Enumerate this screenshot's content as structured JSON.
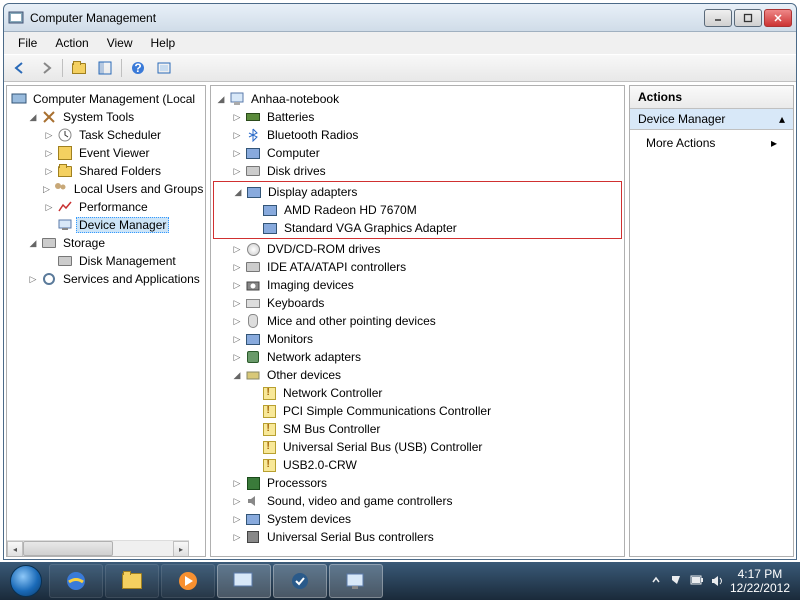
{
  "window": {
    "title": "Computer Management"
  },
  "menus": {
    "file": "File",
    "action": "Action",
    "view": "View",
    "help": "Help"
  },
  "left_tree": {
    "root": "Computer Management (Local",
    "system_tools": "System Tools",
    "task_scheduler": "Task Scheduler",
    "event_viewer": "Event Viewer",
    "shared_folders": "Shared Folders",
    "local_users": "Local Users and Groups",
    "performance": "Performance",
    "device_manager": "Device Manager",
    "storage": "Storage",
    "disk_management": "Disk Management",
    "services_apps": "Services and Applications"
  },
  "mid_tree": {
    "computer": "Anhaa-notebook",
    "batteries": "Batteries",
    "bluetooth": "Bluetooth Radios",
    "computer_cat": "Computer",
    "disk_drives": "Disk drives",
    "display_adapters": "Display adapters",
    "amd_radeon": "AMD Radeon HD 7670M",
    "standard_vga": "Standard VGA Graphics Adapter",
    "dvd": "DVD/CD-ROM drives",
    "ide": "IDE ATA/ATAPI controllers",
    "imaging": "Imaging devices",
    "keyboards": "Keyboards",
    "mice": "Mice and other pointing devices",
    "monitors": "Monitors",
    "network": "Network adapters",
    "other_devices": "Other devices",
    "net_controller": "Network Controller",
    "pci_comm": "PCI Simple Communications Controller",
    "sm_bus": "SM Bus Controller",
    "usb_controller": "Universal Serial Bus (USB) Controller",
    "usb2_crw": "USB2.0-CRW",
    "processors": "Processors",
    "sound": "Sound, video and game controllers",
    "system_devices": "System devices",
    "usb_bus": "Universal Serial Bus controllers"
  },
  "right": {
    "actions": "Actions",
    "section": "Device Manager",
    "more": "More Actions"
  },
  "taskbar": {
    "time": "4:17 PM",
    "date": "12/22/2012"
  }
}
